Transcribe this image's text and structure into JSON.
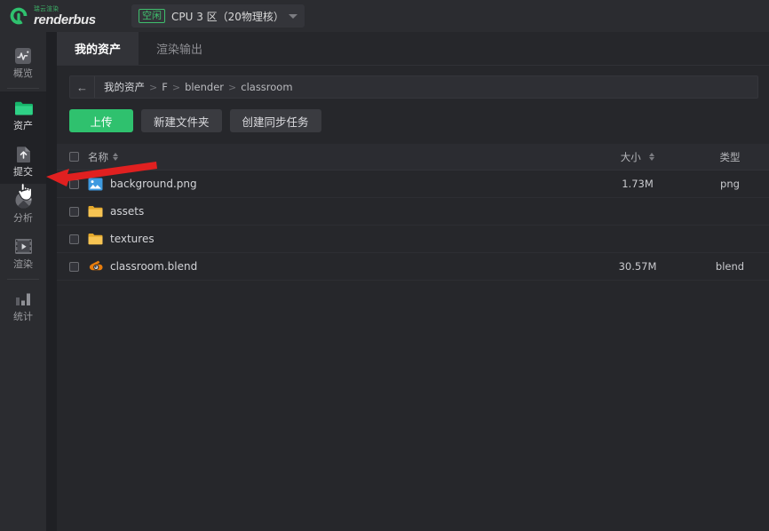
{
  "topbar": {
    "logo_cn": "瑞云渲染",
    "logo_en": "renderbus",
    "zone_badge": "空闲",
    "zone_label": "CPU 3 区（20物理核）"
  },
  "sidebar": {
    "items": [
      {
        "label": "概览",
        "icon": "pulse-icon",
        "active": false
      },
      {
        "label": "资产",
        "icon": "folder-icon",
        "active": true
      },
      {
        "label": "提交",
        "icon": "upload-file-icon",
        "active": false
      },
      {
        "label": "分析",
        "icon": "pie-chart-icon",
        "active": false
      },
      {
        "label": "渲染",
        "icon": "film-play-icon",
        "active": false
      },
      {
        "label": "统计",
        "icon": "bar-chart-icon",
        "active": false
      }
    ]
  },
  "tabs": [
    {
      "label": "我的资产",
      "active": true
    },
    {
      "label": "渲染输出",
      "active": false
    }
  ],
  "breadcrumb": {
    "back_icon": "arrow-left-icon",
    "parts": [
      "我的资产",
      "F",
      "blender",
      "classroom"
    ],
    "separator": ">"
  },
  "buttons": {
    "upload": "上传",
    "new_folder": "新建文件夹",
    "create_sync_task": "创建同步任务"
  },
  "table": {
    "headers": {
      "name": "名称",
      "size": "大小",
      "type": "类型"
    },
    "rows": [
      {
        "name": "background.png",
        "size": "1.73M",
        "type": "png",
        "icon": "image-file-icon"
      },
      {
        "name": "assets",
        "size": "",
        "type": "",
        "icon": "folder-icon"
      },
      {
        "name": "textures",
        "size": "",
        "type": "",
        "icon": "folder-icon"
      },
      {
        "name": "classroom.blend",
        "size": "30.57M",
        "type": "blend",
        "icon": "blender-file-icon"
      }
    ]
  },
  "colors": {
    "brand_green": "#2fc16e",
    "annotation_red": "#e02020",
    "folder_yellow": "#f5bc3c",
    "image_blue": "#3d9ae0",
    "blender_orange": "#e87d0d"
  }
}
